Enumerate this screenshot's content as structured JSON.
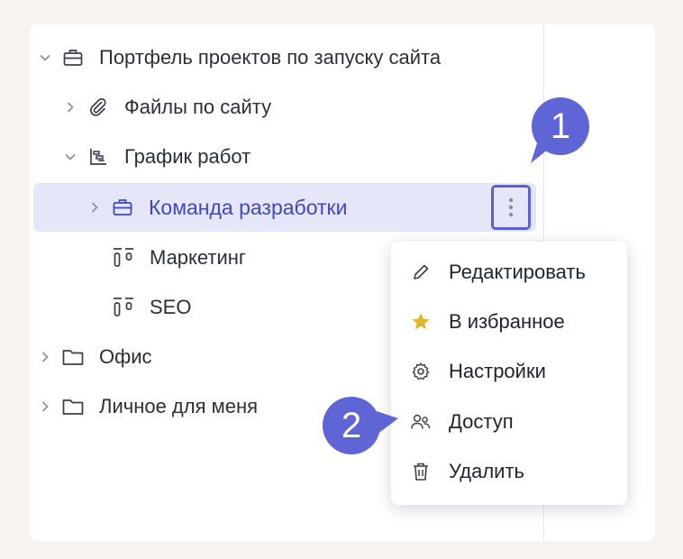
{
  "tree": {
    "items": [
      {
        "label": "Портфель проектов по запуску сайта",
        "icon": "briefcase-icon",
        "expanded": true
      },
      {
        "label": "Файлы по сайту",
        "icon": "paperclip-icon",
        "expanded": false
      },
      {
        "label": "График работ",
        "icon": "gantt-icon",
        "expanded": true
      },
      {
        "label": "Команда разработки",
        "icon": "briefcase-icon",
        "expanded": false,
        "selected": true
      },
      {
        "label": "Маркетинг",
        "icon": "board-icon"
      },
      {
        "label": "SEO",
        "icon": "board-icon"
      },
      {
        "label": "Офис",
        "icon": "folder-icon",
        "expanded": false
      },
      {
        "label": "Личное для меня",
        "icon": "folder-icon",
        "expanded": false
      }
    ]
  },
  "menu": {
    "items": [
      {
        "label": "Редактировать",
        "icon": "pencil-icon"
      },
      {
        "label": "В избранное",
        "icon": "star-icon"
      },
      {
        "label": "Настройки",
        "icon": "gear-icon"
      },
      {
        "label": "Доступ",
        "icon": "users-icon"
      },
      {
        "label": "Удалить",
        "icon": "trash-icon"
      }
    ]
  },
  "callouts": {
    "first": "1",
    "second": "2"
  },
  "colors": {
    "accent": "#3f48c4",
    "selection": "#e5e6f7",
    "badge": "#6065d6",
    "star": "#e2b32c"
  }
}
